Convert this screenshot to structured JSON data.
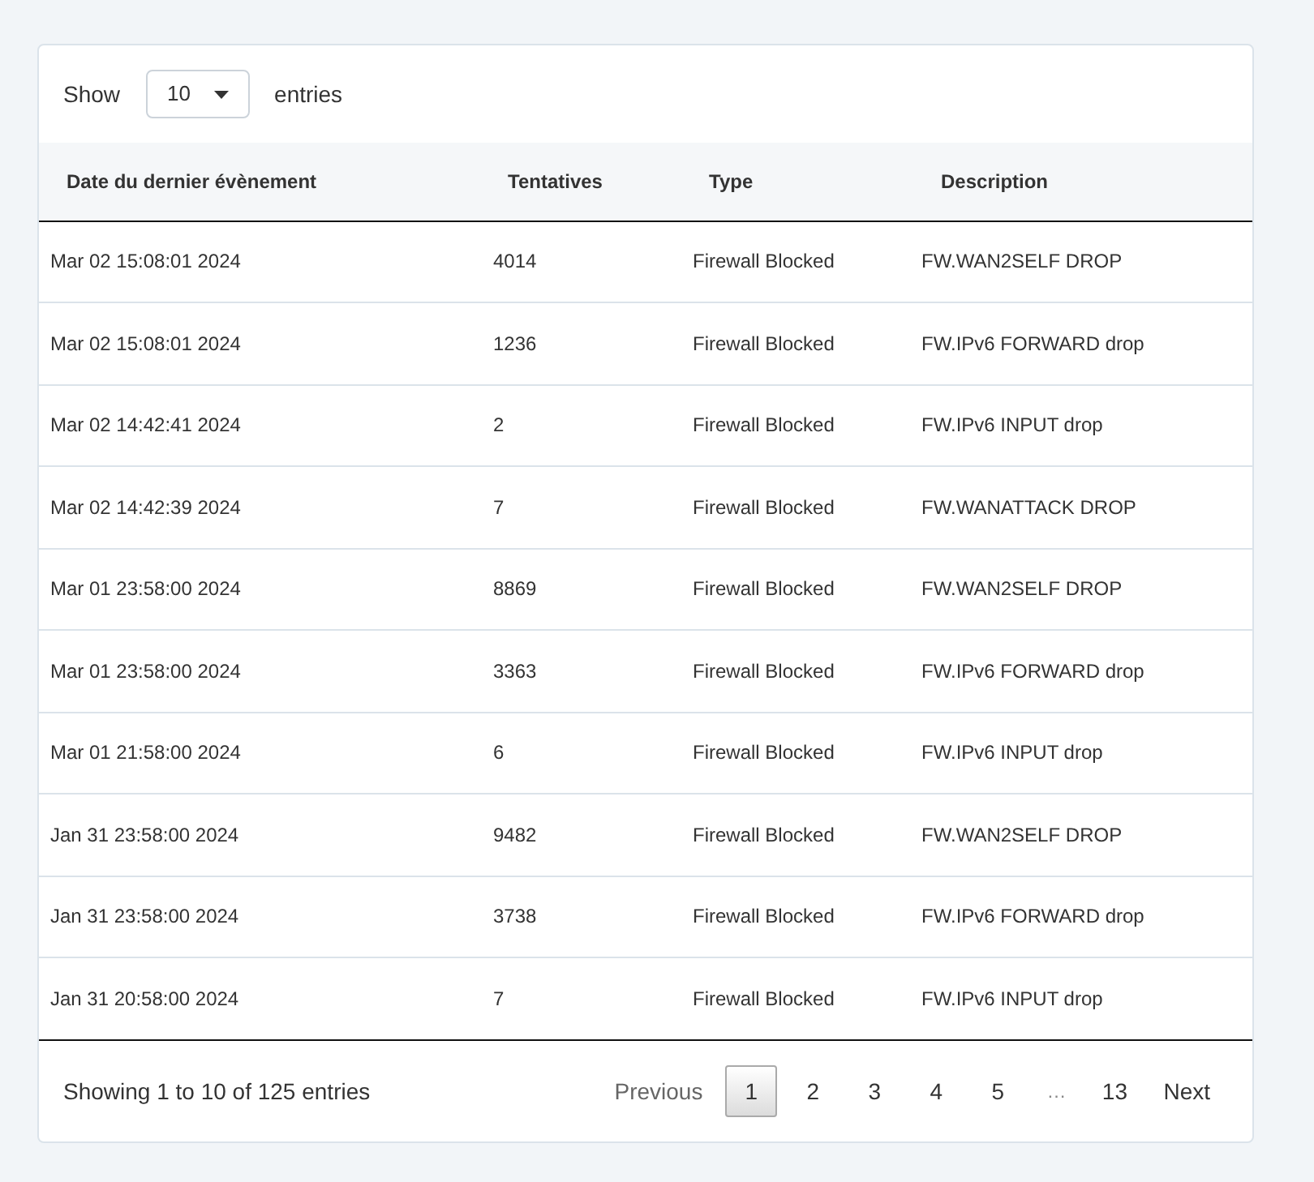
{
  "length_control": {
    "label_before": "Show",
    "value": "10",
    "label_after": "entries"
  },
  "table": {
    "columns": [
      "Date du dernier évènement",
      "Tentatives",
      "Type",
      "Description"
    ],
    "rows": [
      [
        "Mar 02 15:08:01 2024",
        "4014",
        "Firewall Blocked",
        "FW.WAN2SELF DROP"
      ],
      [
        "Mar 02 15:08:01 2024",
        "1236",
        "Firewall Blocked",
        "FW.IPv6 FORWARD drop"
      ],
      [
        "Mar 02 14:42:41 2024",
        "2",
        "Firewall Blocked",
        "FW.IPv6 INPUT drop"
      ],
      [
        "Mar 02 14:42:39 2024",
        "7",
        "Firewall Blocked",
        "FW.WANATTACK DROP"
      ],
      [
        "Mar 01 23:58:00 2024",
        "8869",
        "Firewall Blocked",
        "FW.WAN2SELF DROP"
      ],
      [
        "Mar 01 23:58:00 2024",
        "3363",
        "Firewall Blocked",
        "FW.IPv6 FORWARD drop"
      ],
      [
        "Mar 01 21:58:00 2024",
        "6",
        "Firewall Blocked",
        "FW.IPv6 INPUT drop"
      ],
      [
        "Jan 31 23:58:00 2024",
        "9482",
        "Firewall Blocked",
        "FW.WAN2SELF DROP"
      ],
      [
        "Jan 31 23:58:00 2024",
        "3738",
        "Firewall Blocked",
        "FW.IPv6 FORWARD drop"
      ],
      [
        "Jan 31 20:58:00 2024",
        "7",
        "Firewall Blocked",
        "FW.IPv6 INPUT drop"
      ]
    ]
  },
  "info": "Showing 1 to 10 of 125 entries",
  "pagination": [
    {
      "label": "Previous",
      "kind": "nav",
      "disabled": true
    },
    {
      "label": "1",
      "kind": "page",
      "selected": true
    },
    {
      "label": "2",
      "kind": "page",
      "selected": false
    },
    {
      "label": "3",
      "kind": "page",
      "selected": false
    },
    {
      "label": "4",
      "kind": "page",
      "selected": false
    },
    {
      "label": "5",
      "kind": "page",
      "selected": false
    },
    {
      "label": "…",
      "kind": "ellipsis"
    },
    {
      "label": "13",
      "kind": "page",
      "selected": false
    },
    {
      "label": "Next",
      "kind": "nav",
      "disabled": false
    }
  ]
}
